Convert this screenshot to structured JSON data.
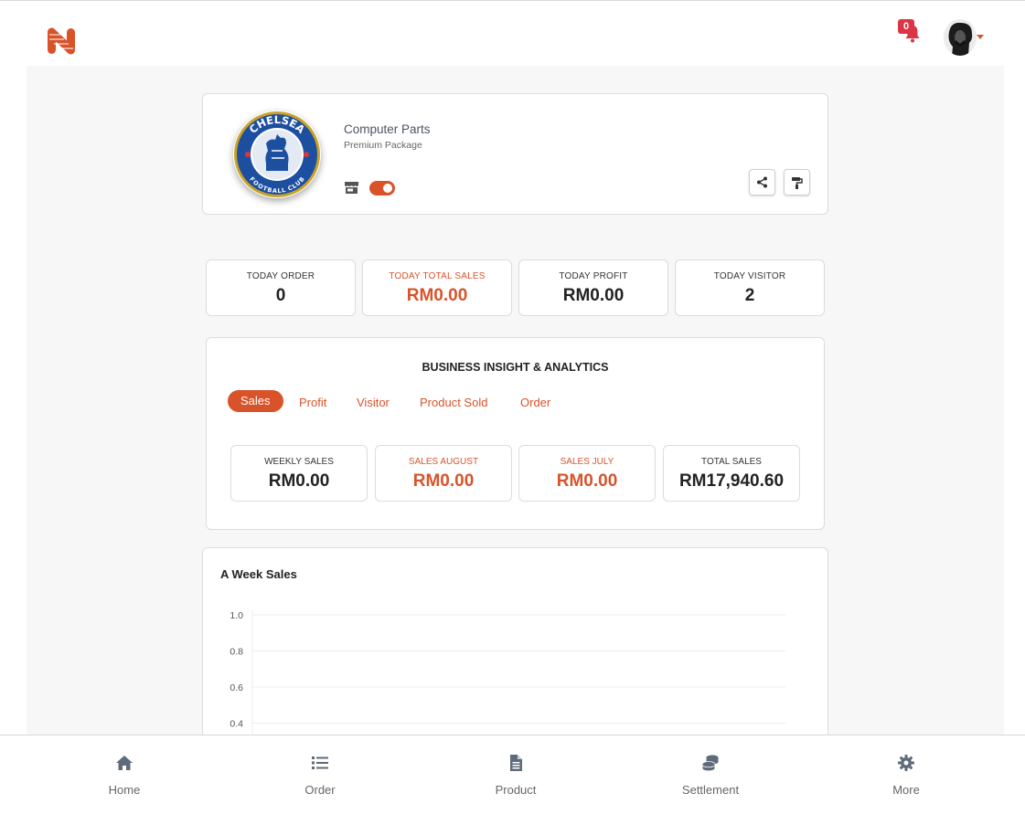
{
  "header": {
    "notification_count": "0",
    "accent_color": "#d9532a"
  },
  "profile": {
    "shop_name": "Computer Parts",
    "package": "Premium Package",
    "store_open": true,
    "crest": {
      "top_text": "CHELSEA",
      "bottom_text": "FOOTBALL CLUB"
    }
  },
  "today_stats": [
    {
      "label": "TODAY ORDER",
      "value": "0",
      "accent": false
    },
    {
      "label": "TODAY TOTAL SALES",
      "value": "RM0.00",
      "accent": true
    },
    {
      "label": "TODAY PROFIT",
      "value": "RM0.00",
      "accent": false
    },
    {
      "label": "TODAY VISITOR",
      "value": "2",
      "accent": false
    }
  ],
  "insights": {
    "title": "BUSINESS INSIGHT & ANALYTICS",
    "tabs": [
      "Sales",
      "Profit",
      "Visitor",
      "Product Sold",
      "Order"
    ],
    "active_tab": "Sales",
    "stats": [
      {
        "label": "WEEKLY SALES",
        "value": "RM0.00",
        "accent": false
      },
      {
        "label": "SALES AUGUST",
        "value": "RM0.00",
        "accent": true
      },
      {
        "label": "SALES JULY",
        "value": "RM0.00",
        "accent": true
      },
      {
        "label": "TOTAL SALES",
        "value": "RM17,940.60",
        "accent": false
      }
    ]
  },
  "chart_data": {
    "type": "line",
    "title": "A Week Sales",
    "y_ticks": [
      "1.0",
      "0.8",
      "0.6",
      "0.4"
    ],
    "ylim": [
      0.4,
      1.0
    ],
    "grid": true,
    "series": []
  },
  "bottom_nav": [
    {
      "label": "Home",
      "icon": "home-icon"
    },
    {
      "label": "Order",
      "icon": "list-icon"
    },
    {
      "label": "Product",
      "icon": "document-icon"
    },
    {
      "label": "Settlement",
      "icon": "coins-icon"
    },
    {
      "label": "More",
      "icon": "gear-icon"
    }
  ]
}
